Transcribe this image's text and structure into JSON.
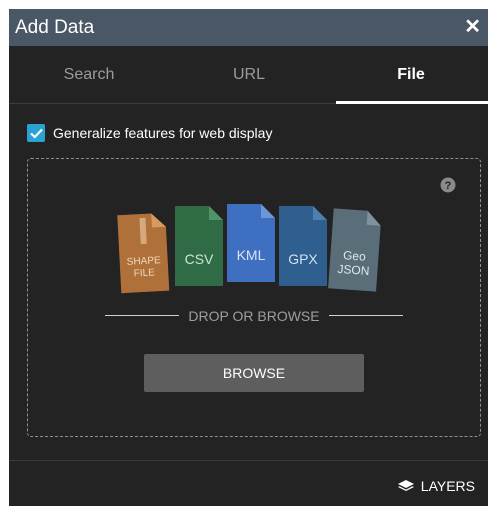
{
  "header": {
    "title": "Add Data",
    "close_icon": "close-icon"
  },
  "tabs": [
    {
      "label": "Search",
      "active": false
    },
    {
      "label": "URL",
      "active": false
    },
    {
      "label": "File",
      "active": true
    }
  ],
  "generalize": {
    "label": "Generalize features for web display",
    "checked": true
  },
  "dropzone": {
    "help_icon": "question-circle-icon",
    "file_types": [
      {
        "label_lines": [
          "SHAPE",
          "FILE"
        ],
        "color": "#b0703a"
      },
      {
        "label_lines": [
          "CSV"
        ],
        "color": "#2f6b45"
      },
      {
        "label_lines": [
          "KML"
        ],
        "color": "#3f6fc1"
      },
      {
        "label_lines": [
          "GPX"
        ],
        "color": "#2f5f8f"
      },
      {
        "label_lines": [
          "Geo",
          "JSON"
        ],
        "color": "#5a6e7a"
      }
    ],
    "drop_text": "DROP OR BROWSE",
    "browse_label": "BROWSE"
  },
  "footer": {
    "layers_label": "LAYERS",
    "layers_icon": "layers-icon"
  },
  "colors": {
    "header_bg": "#495766",
    "panel_bg": "#232323",
    "accent": "#29a3d4",
    "button_bg": "#5e5e5e"
  }
}
